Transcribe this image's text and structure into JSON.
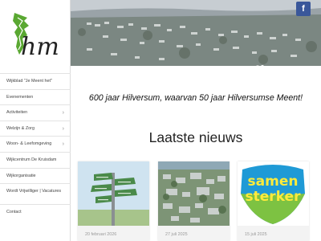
{
  "site": {
    "logo_text": "hm",
    "brand_color": "#2e8b57"
  },
  "sidebar": {
    "items": [
      {
        "label": "Wijkblad \"Je Meent het\"",
        "has_submenu": false
      },
      {
        "label": "Evenementen",
        "has_submenu": false
      },
      {
        "label": "Activiteiten",
        "has_submenu": true
      },
      {
        "label": "Welzijn & Zorg",
        "has_submenu": true
      },
      {
        "label": "Woon- & Leefomgeving",
        "has_submenu": true
      },
      {
        "label": "Wijkcentrum De Kruisdam",
        "has_submenu": false
      },
      {
        "label": "Wijkorganisatie",
        "has_submenu": false
      },
      {
        "label": "Wordt Vrijwilliger | Vacatures",
        "has_submenu": false
      },
      {
        "label": "Contact",
        "has_submenu": false
      }
    ],
    "chevron": "›"
  },
  "hero": {
    "facebook_icon": "f",
    "slides_count": 2,
    "active_slide": 2
  },
  "main": {
    "tagline": "600 jaar Hilversum, waarvan 50 jaar Hilversumse Meent!",
    "news_heading": "Laatste nieuws"
  },
  "news": [
    {
      "date": "20 februari 2026",
      "image": "signpost"
    },
    {
      "date": "27 juli 2025",
      "image": "aerial-town"
    },
    {
      "date": "15 juli 2025",
      "image": "samen-sterker",
      "image_text_1": "samen",
      "image_text_2": "sterker"
    }
  ]
}
